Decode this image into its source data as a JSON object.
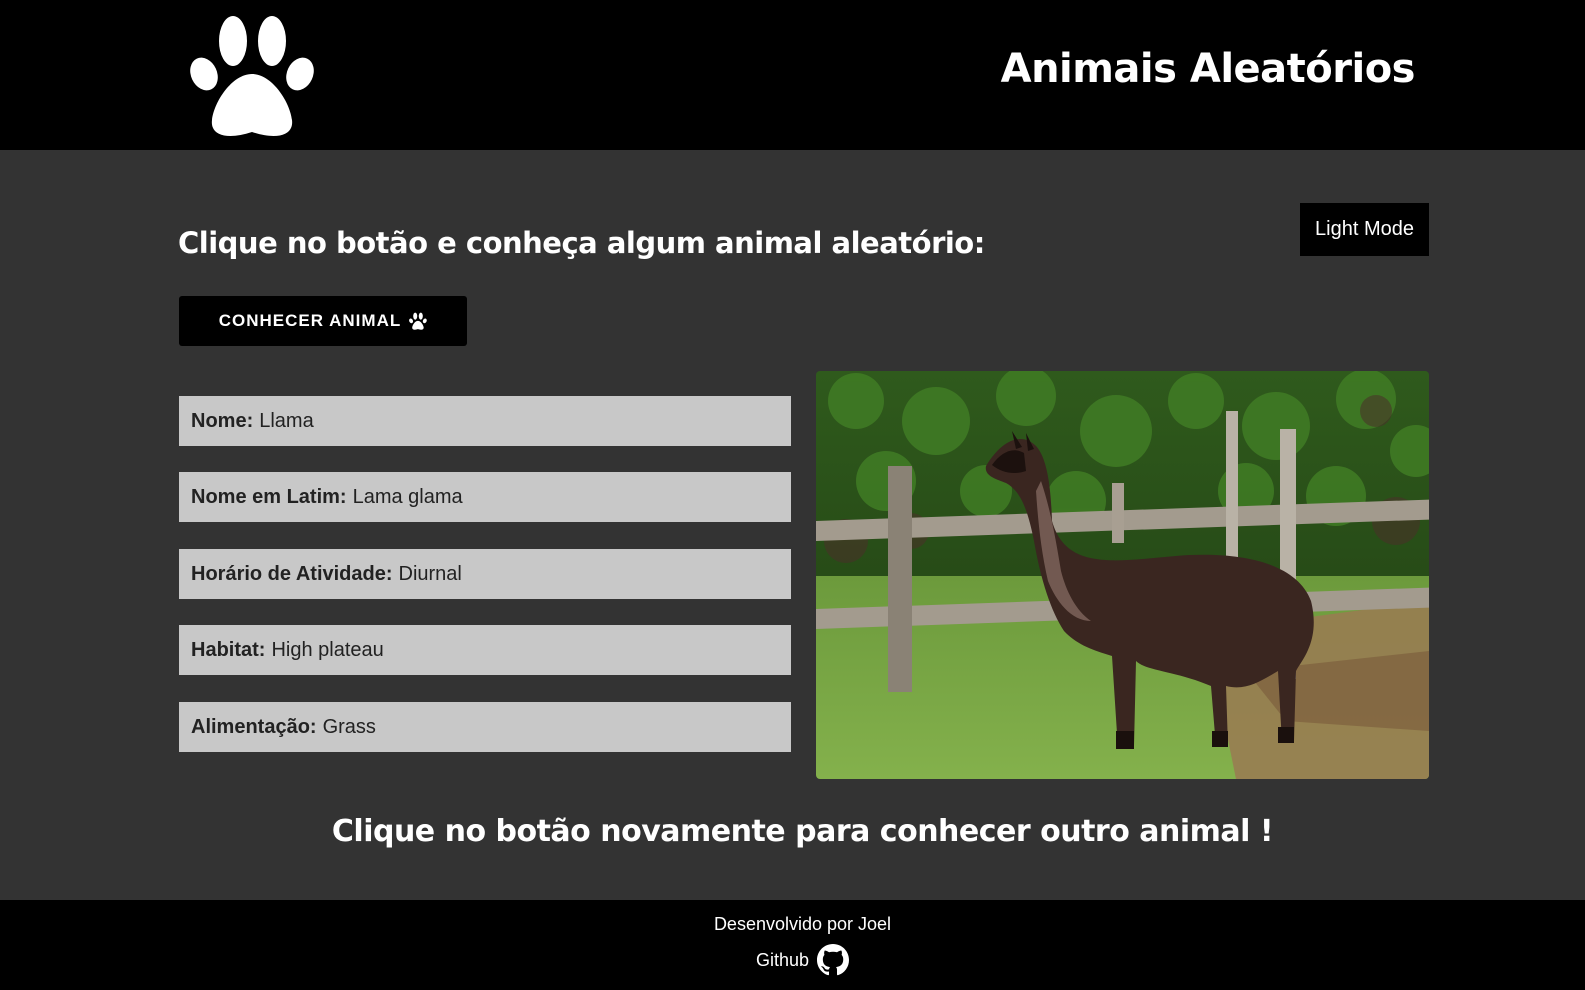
{
  "header": {
    "title": "Animais Aleatórios",
    "logo_icon": "paw-icon"
  },
  "main": {
    "heading": "Clique no botão e conheça algum animal aleatório:",
    "mode_button": "Light Mode",
    "action_button": "CONHECER ANIMAL",
    "fields": [
      {
        "label": "Nome:",
        "value": "Llama"
      },
      {
        "label": "Nome em Latim:",
        "value": "Lama glama"
      },
      {
        "label": "Horário de Atividade:",
        "value": "Diurnal"
      },
      {
        "label": "Habitat:",
        "value": "High plateau"
      },
      {
        "label": "Alimentação:",
        "value": "Grass"
      }
    ],
    "bottom_text": "Clique no botão novamente para conhecer outro animal !"
  },
  "footer": {
    "credit": "Desenvolvido por Joel",
    "github_label": "Github"
  },
  "colors": {
    "header_bg": "#000000",
    "page_bg": "#333333",
    "field_bg": "#c8c8c8"
  }
}
